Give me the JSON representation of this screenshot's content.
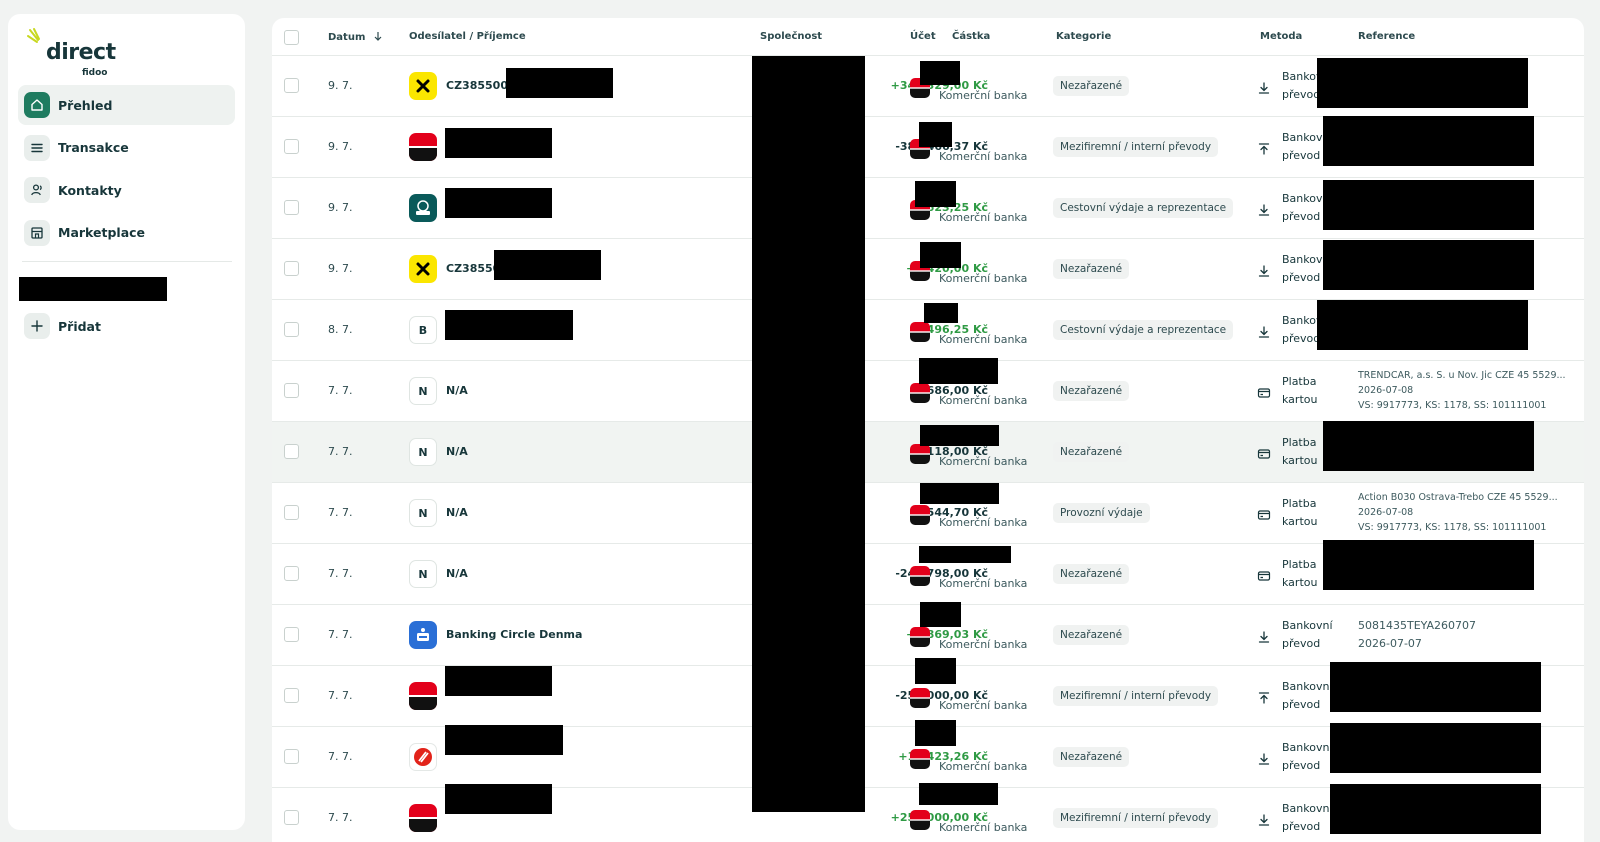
{
  "brand": {
    "name": "direct",
    "sub": "fidoo",
    "accent": "#1f7c60"
  },
  "nav": {
    "items": [
      {
        "label": "Přehled",
        "icon": "home-icon",
        "active": true
      },
      {
        "label": "Transakce",
        "icon": "list-icon",
        "active": false
      },
      {
        "label": "Kontakty",
        "icon": "contacts-icon",
        "active": false
      },
      {
        "label": "Marketplace",
        "icon": "store-icon",
        "active": false
      }
    ],
    "add_label": "Přidat"
  },
  "table": {
    "headers": {
      "date": "Datum",
      "party": "Odesílatel / Příjemce",
      "amount": "Částka",
      "company": "Společnost",
      "account": "Účet",
      "category": "Kategorie",
      "method": "Metoda",
      "reference": "Reference"
    },
    "rows": [
      {
        "date": "9. 7.",
        "avatar": "raiffeisen",
        "name": "CZ385500",
        "amount": "+345 329,00 Kč",
        "sign": "pos",
        "bank": "Komerční banka",
        "category": "Nezařazené",
        "method_l1": "Bankovní",
        "method_l2": "převod",
        "method_icon": "download-icon"
      },
      {
        "date": "9. 7.",
        "avatar": "kb",
        "name": "",
        "amount": "-381 466,37 Kč",
        "sign": "neg",
        "bank": "Komerční banka",
        "category": "Mezifiremní / interní převody",
        "method_l1": "Bankovní",
        "method_l2": "převod",
        "method_icon": "upload-icon"
      },
      {
        "date": "9. 7.",
        "avatar": "csob",
        "name": "",
        "amount": "+623,25 Kč",
        "sign": "pos",
        "bank": "Komerční banka",
        "category": "Cestovní výdaje a reprezentace",
        "method_l1": "Bankovní",
        "method_l2": "převod",
        "method_icon": "download-icon"
      },
      {
        "date": "9. 7.",
        "avatar": "raiffeisen",
        "name": "CZ38550",
        "amount": "+2 420,00 Kč",
        "sign": "pos",
        "bank": "Komerční banka",
        "category": "Nezařazené",
        "method_l1": "Bankovní",
        "method_l2": "převod",
        "method_icon": "download-icon"
      },
      {
        "date": "8. 7.",
        "avatar": "B",
        "name": "",
        "amount": "+496,25 Kč",
        "sign": "pos",
        "bank": "Komerční banka",
        "category": "Cestovní výdaje a reprezentace",
        "method_l1": "Bankovní",
        "method_l2": "převod",
        "method_icon": "download-icon"
      },
      {
        "date": "7. 7.",
        "avatar": "N",
        "name": "N/A",
        "amount": "-9 686,00 Kč",
        "sign": "neg",
        "bank": "Komerční banka",
        "category": "Nezařazené",
        "method_l1": "Platba",
        "method_l2": "kartou",
        "method_icon": "card-icon",
        "ref": [
          "TRENDCAR, a.s. S. u Nov. Jic CZE 45 5529...",
          "2026-07-08",
          "VS: 9917773, KS: 1178, SS: 101111001"
        ]
      },
      {
        "date": "7. 7.",
        "avatar": "N",
        "name": "N/A",
        "amount": "-118,00 Kč",
        "sign": "neg",
        "bank": "Komerční banka",
        "category": "Nezařazené",
        "method_l1": "Platba",
        "method_l2": "kartou",
        "method_icon": "card-icon"
      },
      {
        "date": "7. 7.",
        "avatar": "N",
        "name": "N/A",
        "amount": "-544,70 Kč",
        "sign": "neg",
        "bank": "Komerční banka",
        "category": "Provozní výdaje",
        "method_l1": "Platba",
        "method_l2": "kartou",
        "method_icon": "card-icon",
        "ref": [
          "Action B030 Ostrava-Trebo CZE 45 5529...",
          "2026-07-08",
          "VS: 9917773, KS: 1178, SS: 101111001"
        ]
      },
      {
        "date": "7. 7.",
        "avatar": "N",
        "name": "N/A",
        "amount": "-242 798,00 Kč",
        "sign": "neg",
        "bank": "Komerční banka",
        "category": "Nezařazené",
        "method_l1": "Platba",
        "method_l2": "kartou",
        "method_icon": "card-icon"
      },
      {
        "date": "7. 7.",
        "avatar": "sparkasse",
        "name": "Banking Circle Denma",
        "amount": "+9 869,03 Kč",
        "sign": "pos",
        "bank": "Komerční banka",
        "category": "Nezařazené",
        "method_l1": "Bankovní",
        "method_l2": "převod",
        "method_icon": "download-icon",
        "ref_lg": [
          "5081435TEYA260707",
          "2026-07-07"
        ]
      },
      {
        "date": "7. 7.",
        "avatar": "kb",
        "name": "",
        "amount": "-250 000,00 Kč",
        "sign": "neg",
        "bank": "Komerční banka",
        "category": "Mezifiremní / interní převody",
        "method_l1": "Bankovní",
        "method_l2": "převod",
        "method_icon": "upload-icon"
      },
      {
        "date": "7. 7.",
        "avatar": "unicredit",
        "name": "",
        "amount": "+10 423,26 Kč",
        "sign": "pos",
        "bank": "Komerční banka",
        "category": "Nezařazené",
        "method_l1": "Bankovní",
        "method_l2": "převod",
        "method_icon": "download-icon"
      },
      {
        "date": "7. 7.",
        "avatar": "kb",
        "name": "",
        "amount": "+250 000,00 Kč",
        "sign": "pos",
        "bank": "Komerční banka",
        "category": "Mezifiremní / interní převody",
        "method_l1": "Bankovní",
        "method_l2": "převod",
        "method_icon": "download-icon"
      }
    ]
  }
}
